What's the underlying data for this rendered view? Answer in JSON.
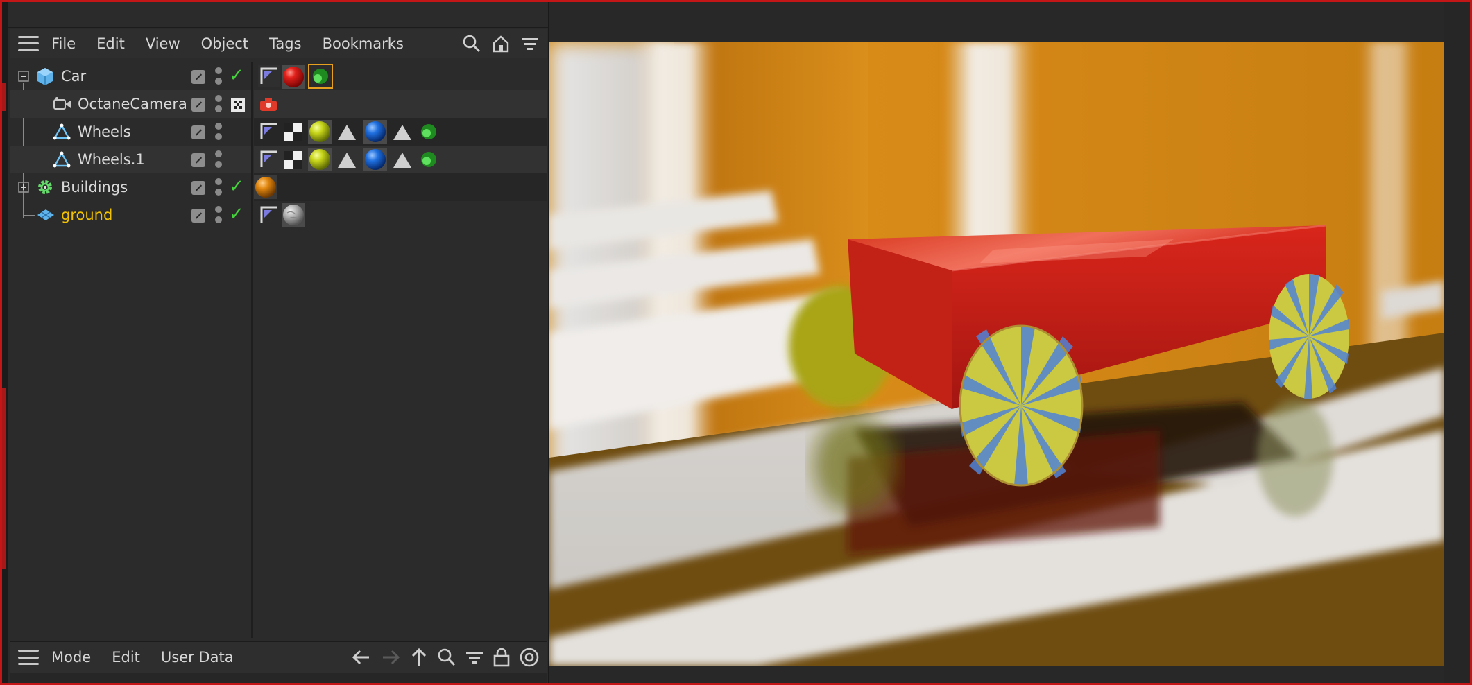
{
  "object_manager": {
    "menu": [
      "File",
      "Edit",
      "View",
      "Object",
      "Tags",
      "Bookmarks"
    ],
    "tools": [
      "search-icon",
      "home-icon",
      "filter-icon"
    ],
    "objects": [
      {
        "name": "Car",
        "icon": "cube-icon",
        "expand": "minus",
        "checked": true
      },
      {
        "name": "OctaneCamera",
        "icon": "camera-icon",
        "expand": "",
        "checked": false
      },
      {
        "name": "Wheels",
        "icon": "symmetry-icon",
        "expand": "",
        "checked": false
      },
      {
        "name": "Wheels.1",
        "icon": "symmetry-icon",
        "expand": "",
        "checked": false
      },
      {
        "name": "Buildings",
        "icon": "gear-icon",
        "expand": "plus",
        "checked": true
      },
      {
        "name": "ground",
        "icon": "plane-icon",
        "expand": "",
        "checked": true
      }
    ]
  },
  "attributes": {
    "menu": [
      "Mode",
      "Edit",
      "User Data"
    ],
    "tools": [
      "arrow-left-icon",
      "arrow-right-icon",
      "arrow-up-icon",
      "search-icon",
      "filter-icon",
      "lock-icon",
      "target-icon"
    ]
  },
  "colors": {
    "selected_text": "#f2c200",
    "check": "#45d13b",
    "border": "#c41616",
    "car_red": "#d61b12",
    "wheel_yellow": "#c9d21a",
    "wheel_blue": "#1e6fe0",
    "building_orange": "#d9800d"
  }
}
